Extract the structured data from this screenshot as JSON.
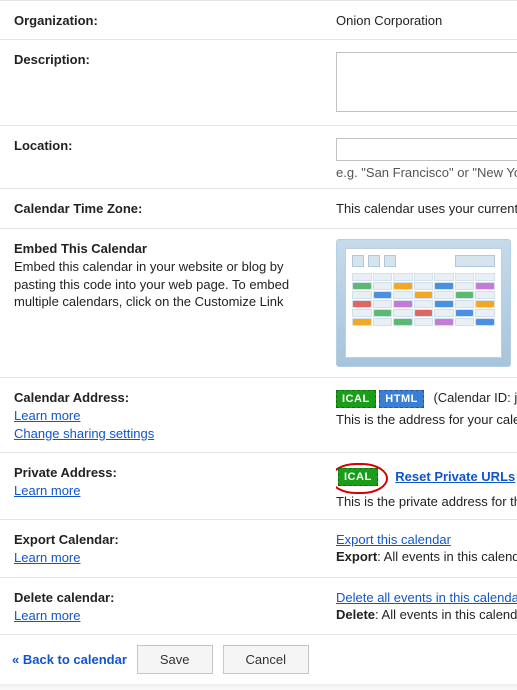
{
  "rows": {
    "organization": {
      "label": "Organization:",
      "value": "Onion Corporation"
    },
    "description": {
      "label": "Description:"
    },
    "location": {
      "label": "Location:",
      "value": "",
      "hint": "e.g. \"San Francisco\" or \"New York"
    },
    "timezone": {
      "label": "Calendar Time Zone:",
      "value": "This calendar uses your current ti"
    },
    "embed": {
      "label": "Embed This Calendar",
      "sub": "Embed this calendar in your website or blog by pasting this code into your web page. To embed multiple calendars, click on the Customize Link"
    },
    "caladdr": {
      "label": "Calendar Address:",
      "learn": "Learn more",
      "change": "Change sharing settings",
      "ical": "ICAL",
      "html": "HTML",
      "calid": "(Calendar ID: jame",
      "desc": "This is the address for your calen"
    },
    "private": {
      "label": "Private Address:",
      "learn": "Learn more",
      "ical": "ICAL",
      "reset": "Reset Private URLs",
      "desc": "This is the private address for this"
    },
    "export": {
      "label": "Export Calendar:",
      "learn": "Learn more",
      "link": "Export this calendar",
      "boldprefix": "Export",
      "rest": ": All events in this calendar"
    },
    "del": {
      "label": "Delete calendar:",
      "learn": "Learn more",
      "link": "Delete all events in this calendar",
      "boldprefix": "Delete",
      "rest": ": All events in this calendar"
    }
  },
  "footer": {
    "back": "« Back to calendar",
    "save": "Save",
    "cancel": "Cancel"
  }
}
